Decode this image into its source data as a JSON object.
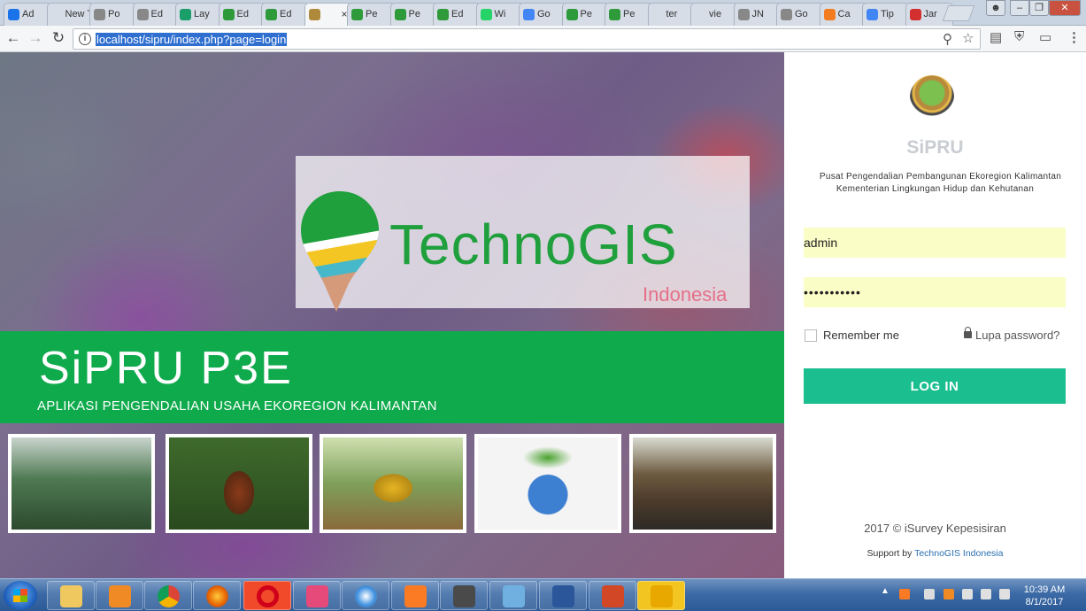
{
  "browser": {
    "tabs": [
      {
        "label": "Ad",
        "favicon": "#1a73e8"
      },
      {
        "label": "New T",
        "favicon": ""
      },
      {
        "label": "Po",
        "favicon": "#888"
      },
      {
        "label": "Ed",
        "favicon": "#888"
      },
      {
        "label": "Lay",
        "favicon": "#1a9e6a"
      },
      {
        "label": "Ed",
        "favicon": "#2e9a3a"
      },
      {
        "label": "Ed",
        "favicon": "#2e9a3a"
      },
      {
        "label": "×",
        "favicon": "#b08a3c"
      },
      {
        "label": "Pe",
        "favicon": "#2e9a3a"
      },
      {
        "label": "Pe",
        "favicon": "#2e9a3a"
      },
      {
        "label": "Ed",
        "favicon": "#2e9a3a"
      },
      {
        "label": "Wi",
        "favicon": "#25d366"
      },
      {
        "label": "Go",
        "favicon": "#4285f4"
      },
      {
        "label": "Pe",
        "favicon": "#2e9a3a"
      },
      {
        "label": "Pe",
        "favicon": "#2e9a3a"
      },
      {
        "label": "ter",
        "favicon": ""
      },
      {
        "label": "vie",
        "favicon": ""
      },
      {
        "label": "JN",
        "favicon": "#888"
      },
      {
        "label": "Go",
        "favicon": "#888"
      },
      {
        "label": "Ca",
        "favicon": "#f47c20"
      },
      {
        "label": "Tip",
        "favicon": "#4285f4"
      },
      {
        "label": "Jar",
        "favicon": "#d32f2f"
      }
    ],
    "url": "localhost/sipru/index.php?page=login"
  },
  "hero": {
    "logo_text": "TechnoGIS",
    "logo_sub": "Indonesia",
    "banner_title": "SiPRU P3E",
    "banner_subtitle": "APLIKASI PENGENDALIAN USAHA EKOREGION KALIMANTAN",
    "photos": [
      "forest",
      "orangutan",
      "excavator",
      "earth-tree",
      "mining-site"
    ]
  },
  "login": {
    "brand": "SiPRU",
    "org_line1": "Pusat Pengendalian Pembangunan Ekoregion Kalimantan",
    "org_line2": "Kementerian Lingkungan Hidup dan Kehutanan",
    "username_value": "admin",
    "password_value": "•••••••••••",
    "remember_label": "Remember me",
    "forgot_label": "Lupa password?",
    "login_button": "LOG IN",
    "copyright": "2017 © iSurvey Kepesisiran",
    "support_prefix": "Support by",
    "support_link": "TechnoGIS Indonesia"
  },
  "taskbar": {
    "time": "10:39 AM",
    "date": "8/1/2017"
  },
  "colors": {
    "banner_green": "#0faa4c",
    "login_button": "#1bbf8f",
    "input_bg": "#fbfdc6",
    "logo_green": "#1fa03c"
  }
}
